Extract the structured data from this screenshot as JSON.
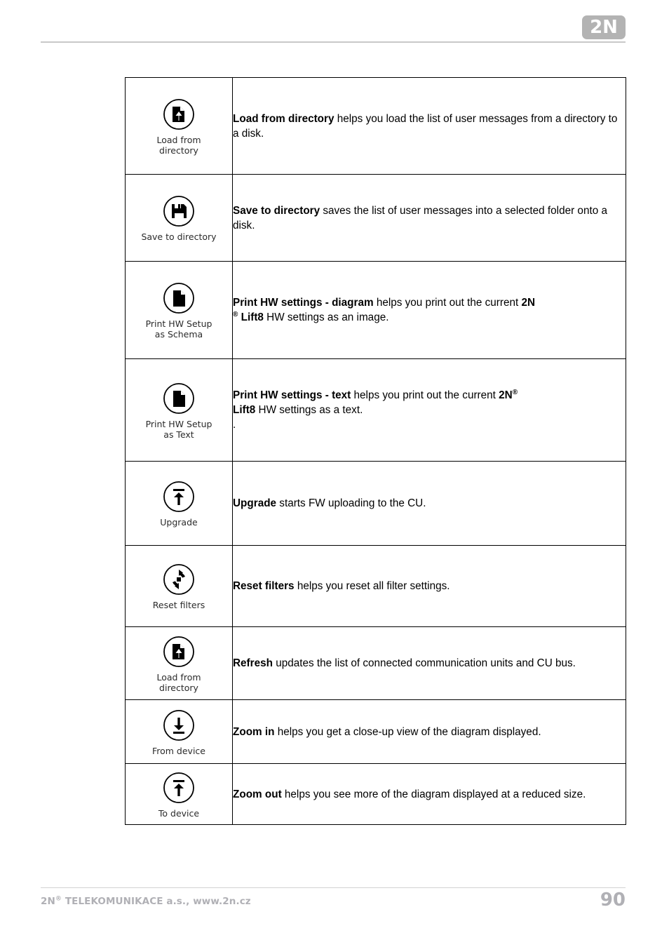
{
  "header": {
    "logo_text": "2N"
  },
  "table": {
    "rows": [
      {
        "icon_name": "load-from-directory-icon",
        "icon_glyph": "document-up-arrow",
        "icon_label": "Load from\ndirectory",
        "term": "Load from directory",
        "description": " helps you load the list of user messages from a directory to a disk.",
        "align": "top"
      },
      {
        "icon_name": "save-to-directory-icon",
        "icon_glyph": "floppy-disk",
        "icon_label": "Save to directory",
        "term": "Save to directory",
        "description": " saves the list of user messages into a selected folder onto a disk.",
        "align": "middle"
      },
      {
        "icon_name": "print-hw-setup-as-schema-icon",
        "icon_glyph": "document-page",
        "icon_label": "Print HW Setup\nas Schema",
        "term": "Print HW settings - diagram",
        "description": " helps you print out the current ",
        "brand": "2N",
        "brand_sup": "®",
        "product": "Lift8",
        "description_tail": " HW settings as an image.",
        "align": "middle",
        "brand_break": "after-2n"
      },
      {
        "icon_name": "print-hw-setup-as-text-icon",
        "icon_glyph": "document-page",
        "icon_label": "Print HW Setup\nas Text",
        "term": "Print HW settings - text",
        "description": " helps you print out the current ",
        "brand": "2N",
        "brand_sup": "®",
        "product": "Lift8",
        "description_tail": " HW settings as a text.",
        "extra_line": ".",
        "align": "middle",
        "brand_break": "after-sup"
      },
      {
        "icon_name": "upgrade-icon",
        "icon_glyph": "arrow-up-bar",
        "icon_label": "Upgrade",
        "term": "Upgrade",
        "description": " starts FW uploading to the CU.",
        "align": "middle"
      },
      {
        "icon_name": "reset-filters-icon",
        "icon_glyph": "refresh-circular",
        "icon_label": "Reset filters",
        "term": "Reset filters",
        "description": " helps you reset all filter settings.",
        "align": "middle"
      },
      {
        "icon_name": "refresh-load-from-directory-icon",
        "icon_glyph": "document-up-arrow",
        "icon_label": "Load from\ndirectory",
        "term": "Refresh",
        "description": " updates the list of connected communication units and CU bus.",
        "align": "middle"
      },
      {
        "icon_name": "from-device-icon",
        "icon_glyph": "arrow-down-bar",
        "icon_label": "From device",
        "term": "Zoom in",
        "description": " helps you get a close-up view of the diagram displayed.",
        "align": "middle"
      },
      {
        "icon_name": "to-device-icon",
        "icon_glyph": "arrow-up-bar",
        "icon_label": "To device",
        "term": "Zoom out",
        "description": " helps you see more of the diagram displayed at a reduced size.",
        "align": "middle"
      }
    ]
  },
  "footer": {
    "company": "2N",
    "company_sup": "®",
    "company_tail": " TELEKOMUNIKACE a.s., www.2n.cz",
    "page_number": "90"
  },
  "colors": {
    "logo_gray": "#b3b3b3",
    "rule_gray": "#c8c8c8",
    "footer_gray": "#b0b0b5",
    "border_black": "#000000",
    "icon_label_gray": "#2b2b2b"
  }
}
